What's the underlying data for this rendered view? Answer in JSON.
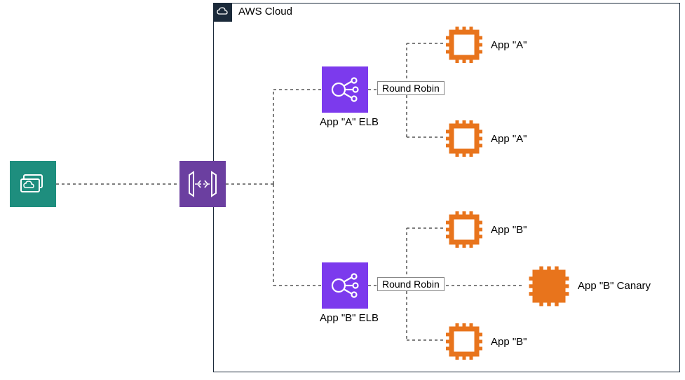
{
  "cloud": {
    "title": "AWS Cloud"
  },
  "nodes": {
    "client": {
      "name": "client-icon"
    },
    "gateway": {
      "name": "api-gateway-icon"
    },
    "elb_a": {
      "label": "App \"A\" ELB",
      "rr": "Round Robin"
    },
    "elb_b": {
      "label": "App \"B\" ELB",
      "rr": "Round Robin"
    },
    "app_a1": {
      "label": "App \"A\""
    },
    "app_a2": {
      "label": "App \"A\""
    },
    "app_b1": {
      "label": "App \"B\""
    },
    "app_b2": {
      "label": "App \"B\""
    },
    "app_b_canary": {
      "label": "App \"B\" Canary"
    }
  },
  "colors": {
    "chip_orange": "#E8741C",
    "chip_fill_orange": "#E8741C",
    "elb_purple": "#7C3AED",
    "gateway_purple": "#6B3FA0",
    "client_teal": "#1E8E7E",
    "cloud_border": "#1b2a3a"
  }
}
